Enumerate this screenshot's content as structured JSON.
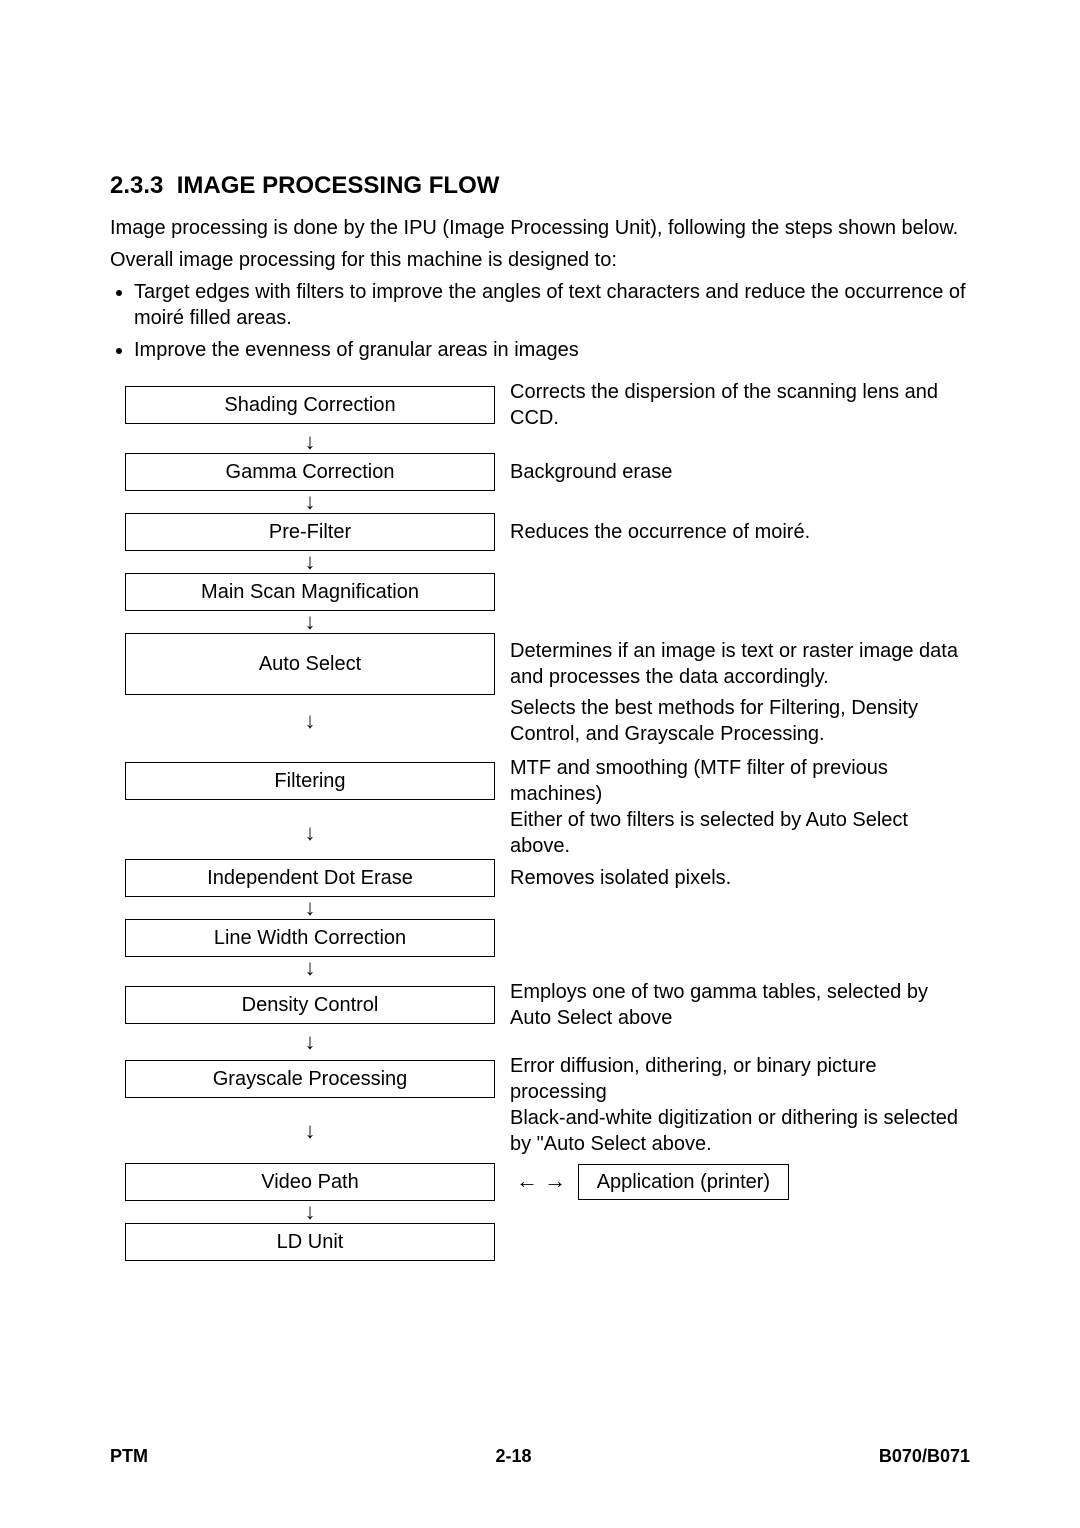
{
  "heading_num": "2.3.3",
  "heading_title": "IMAGE PROCESSING FLOW",
  "intro_p1": "Image processing is done by the IPU (Image Processing Unit), following the steps shown below.",
  "intro_p2": "Overall image processing for this machine is designed to:",
  "bullets": {
    "b1": "Target edges with filters to improve the angles of text characters and reduce the occurrence of moiré filled areas.",
    "b2": "Improve the evenness of granular areas in images"
  },
  "flow": {
    "shading": {
      "label": "Shading Correction",
      "desc": "Corrects the dispersion of the scanning lens and CCD."
    },
    "gamma": {
      "label": "Gamma Correction",
      "desc": "Background erase"
    },
    "prefilter": {
      "label": "Pre-Filter",
      "desc": "Reduces the occurrence of moiré."
    },
    "magnification": {
      "label": "Main Scan Magnification",
      "desc": ""
    },
    "autoselect": {
      "label": "Auto Select",
      "desc": "Determines if an image is text or raster image data and processes the data accordingly."
    },
    "autoselect_arrow_desc": "Selects the best methods for Filtering, Density Control, and Grayscale Processing.",
    "filtering": {
      "label": "Filtering",
      "desc": "MTF and smoothing (MTF filter of previous machines)"
    },
    "filtering_arrow_desc": "Either of two filters is selected by Auto Select above.",
    "doterase": {
      "label": "Independent Dot Erase",
      "desc": "Removes isolated pixels."
    },
    "linewidth": {
      "label": "Line Width Correction",
      "desc": ""
    },
    "density": {
      "label": "Density Control",
      "desc": "Employs one of two gamma tables, selected by Auto Select above"
    },
    "grayscale": {
      "label": "Grayscale Processing",
      "desc": "Error diffusion, dithering, or binary picture processing"
    },
    "grayscale_arrow_desc": "Black-and-white digitization or dithering is selected by \"Auto Select above.",
    "videopath": {
      "label": "Video Path"
    },
    "application": {
      "label": "Application (printer)"
    },
    "ldunit": {
      "label": "LD Unit"
    }
  },
  "arrow_down": "↓",
  "arrow_bidir": "← →",
  "footer": {
    "left": "PTM",
    "center": "2-18",
    "right": "B070/B071"
  }
}
